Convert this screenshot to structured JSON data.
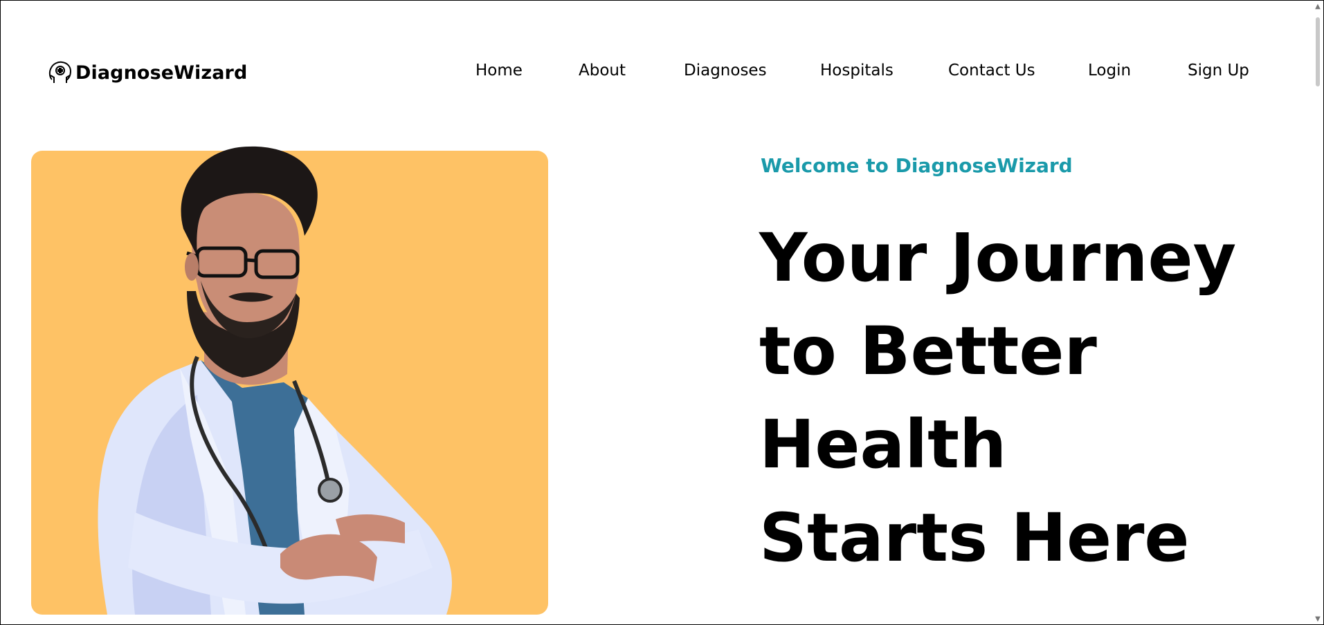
{
  "brand": {
    "name": "DiagnoseWizard",
    "icon": "doctor-head-icon"
  },
  "nav": {
    "items": [
      {
        "label": "Home"
      },
      {
        "label": "About"
      },
      {
        "label": "Diagnoses"
      },
      {
        "label": "Hospitals"
      },
      {
        "label": "Contact Us"
      },
      {
        "label": "Login"
      },
      {
        "label": "Sign Up"
      }
    ]
  },
  "hero": {
    "welcome": "Welcome to DiagnoseWizard",
    "headline": "Your Journey to Better Health Starts Here",
    "image": "doctor-portrait",
    "card_color": "#fec265"
  },
  "colors": {
    "accent": "#1a9aaa",
    "text": "#000000",
    "background": "#ffffff"
  },
  "scrollbar": {
    "up_icon": "chevron-up-icon",
    "down_icon": "chevron-down-icon"
  }
}
